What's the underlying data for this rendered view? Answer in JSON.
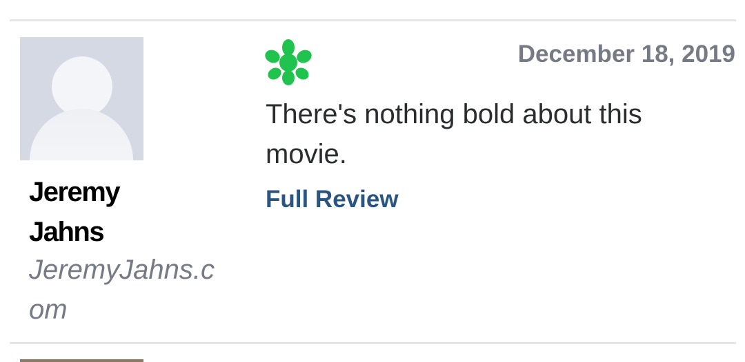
{
  "review": {
    "critic_name": "Jeremy Jahns",
    "publication": "JeremyJahns.com",
    "rating_icon": "rotten-splat-icon",
    "rating_color": "#1fc34e",
    "date": "December 18, 2019",
    "quote": "There's nothing bold about this movie.",
    "full_review_label": "Full Review",
    "link_color": "#2a5580"
  }
}
